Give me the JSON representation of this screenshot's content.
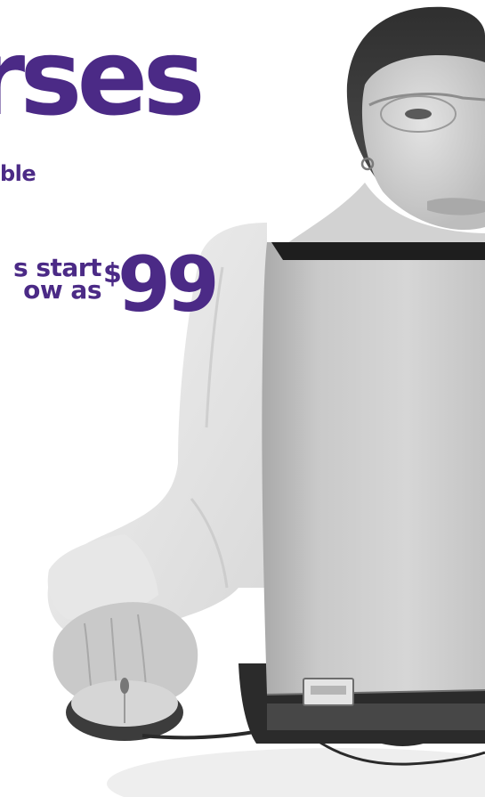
{
  "colors": {
    "brand": "#4b2a86",
    "background": "#ffffff"
  },
  "ad": {
    "headline": "rses",
    "subhead": "ble",
    "promo_line1": "s start",
    "promo_line2": "ow as",
    "price_currency": "$",
    "price_amount": "99"
  },
  "image": {
    "subject": "woman-using-laptop-and-mouse"
  }
}
